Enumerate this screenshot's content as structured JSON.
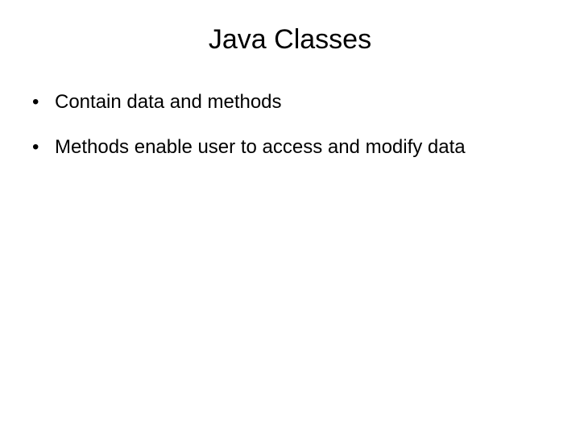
{
  "slide": {
    "title": "Java Classes",
    "bullets": [
      "Contain data and methods",
      "Methods enable user to access and modify data"
    ]
  }
}
